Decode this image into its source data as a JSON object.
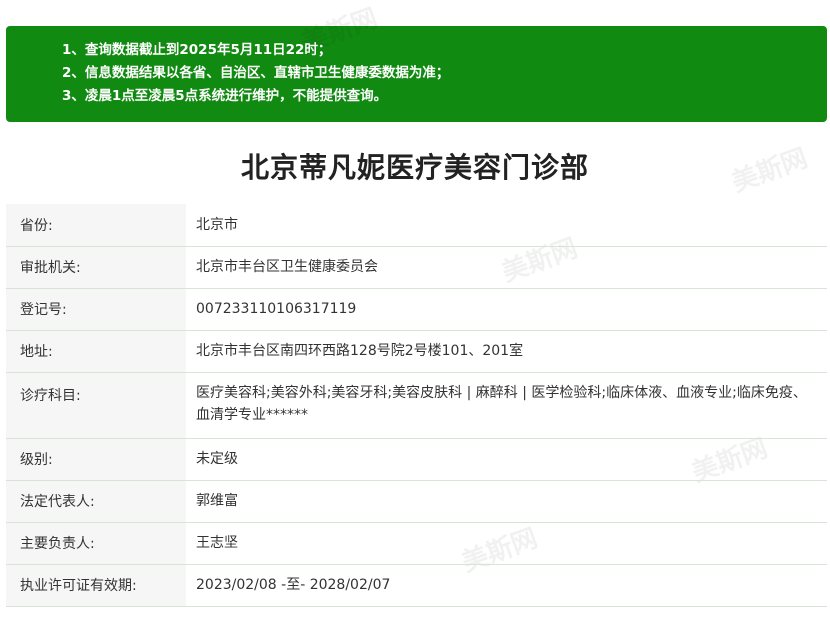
{
  "notice": {
    "lines": [
      "1、查询数据截止到2025年5月11日22时；",
      "2、信息数据结果以各省、自治区、直辖市卫生健康委数据为准；",
      "3、凌晨1点至凌晨5点系统进行维护，不能提供查询。"
    ]
  },
  "title": "北京蒂凡妮医疗美容门诊部",
  "rows": [
    {
      "label": "省份:",
      "value": "北京市"
    },
    {
      "label": "审批机关:",
      "value": "北京市丰台区卫生健康委员会"
    },
    {
      "label": "登记号:",
      "value": "007233110106317119"
    },
    {
      "label": "地址:",
      "value": "北京市丰台区南四环西路128号院2号楼101、201室"
    },
    {
      "label": "诊疗科目:",
      "value": "医疗美容科;美容外科;美容牙科;美容皮肤科 | 麻醉科 | 医学检验科;临床体液、血液专业;临床免疫、血清学专业******"
    },
    {
      "label": "级别:",
      "value": "未定级"
    },
    {
      "label": "法定代表人:",
      "value": "郭维富"
    },
    {
      "label": "主要负责人:",
      "value": "王志坚"
    },
    {
      "label": "执业许可证有效期:",
      "value": "2023/02/08 -至- 2028/02/07"
    }
  ],
  "watermark": "美斯网"
}
